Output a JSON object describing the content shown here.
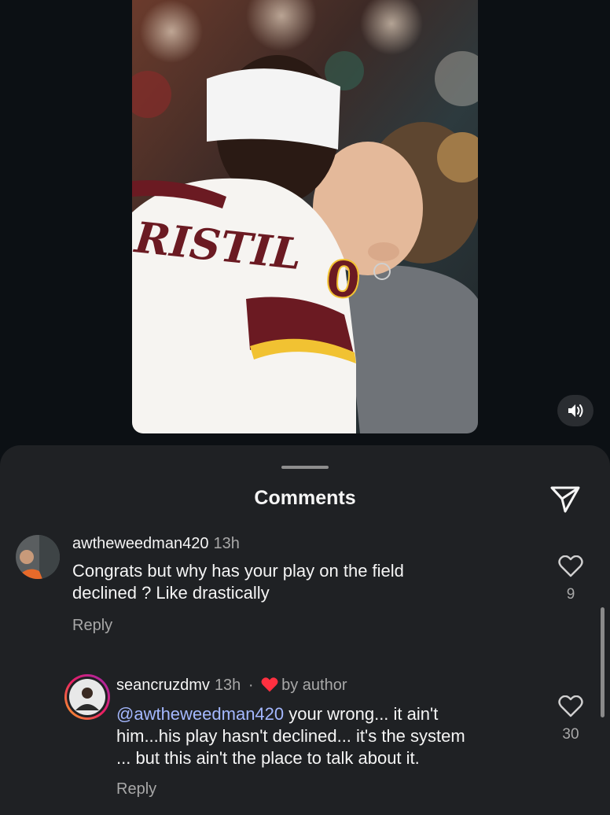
{
  "media": {
    "jersey_text": "RISTIL",
    "jersey_number": "0",
    "audio_icon": "speaker-icon"
  },
  "sheet": {
    "title": "Comments",
    "share_icon": "send-icon"
  },
  "comments": [
    {
      "username": "awtheweedman420",
      "time": "13h",
      "text_lines": [
        "Congrats but why has your play on the field",
        "declined ? Like drastically"
      ],
      "reply_label": "Reply",
      "likes": "9"
    },
    {
      "username": "seancruzdmv",
      "time": "13h",
      "separator": "·",
      "badge": "by author",
      "mention": "@awtheweedman420",
      "text_line1_rest": " your wrong... it ain't",
      "text_line2": "him...his play hasn't declined... it's the system",
      "text_line3": "... but this ain't the place to talk about it.",
      "reply_label": "Reply",
      "likes": "30"
    }
  ],
  "colors": {
    "background": "#0c1014",
    "sheet": "#1f2124",
    "mention": "#a4b8ff",
    "author_heart": "#ff3040",
    "jersey_burgundy": "#6b1a22",
    "jersey_gold": "#f1c232"
  }
}
